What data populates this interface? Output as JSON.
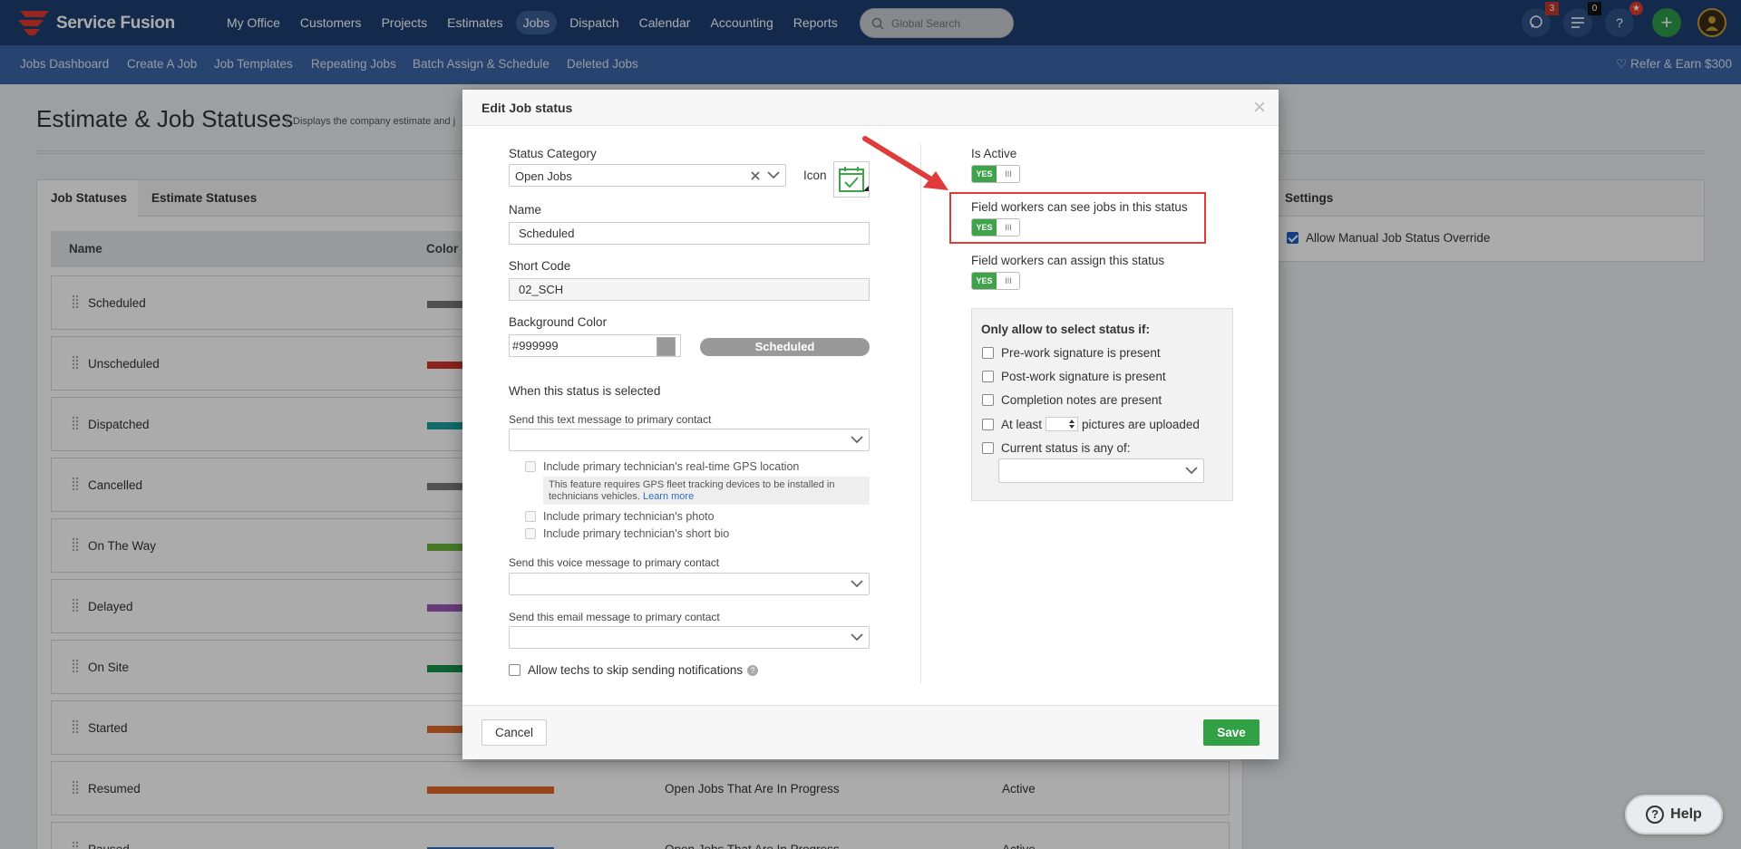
{
  "app": {
    "brand": "Service Fusion",
    "nav": [
      "My Office",
      "Customers",
      "Projects",
      "Estimates",
      "Jobs",
      "Dispatch",
      "Calendar",
      "Accounting",
      "Reports"
    ],
    "active_nav": "Jobs",
    "search_placeholder": "Global Search",
    "badges": {
      "chat": "3",
      "list": "0"
    },
    "help_icon_label": "?",
    "plus_label": "+"
  },
  "subnav": {
    "items": [
      "Jobs Dashboard",
      "Create A Job",
      "Job Templates",
      "Repeating Jobs",
      "Batch Assign & Schedule",
      "Deleted Jobs"
    ],
    "refer": "Refer & Earn $300"
  },
  "page": {
    "title": "Estimate & Job Statuses",
    "subtitle": "Displays the company estimate and j"
  },
  "tabs": [
    "Job Statuses",
    "Estimate Statuses"
  ],
  "table": {
    "headers": {
      "name": "Name",
      "color": "Color"
    },
    "rows": [
      {
        "name": "Scheduled",
        "color": "#7a7a7a",
        "category": "",
        "status": ""
      },
      {
        "name": "Unscheduled",
        "color": "#d0342c",
        "category": "",
        "status": ""
      },
      {
        "name": "Dispatched",
        "color": "#1a9d9d",
        "category": "",
        "status": ""
      },
      {
        "name": "Cancelled",
        "color": "#7a7a7a",
        "category": "",
        "status": ""
      },
      {
        "name": "On The Way",
        "color": "#6bb53e",
        "category": "",
        "status": ""
      },
      {
        "name": "Delayed",
        "color": "#9b59b6",
        "category": "",
        "status": ""
      },
      {
        "name": "On Site",
        "color": "#17934e",
        "category": "",
        "status": ""
      },
      {
        "name": "Started",
        "color": "#e06a2a",
        "category": "",
        "status": ""
      },
      {
        "name": "Resumed",
        "color": "#e0662a",
        "category": "Open Jobs That Are In Progress",
        "status": "Active"
      },
      {
        "name": "Paused",
        "color": "#2c6fc0",
        "category": "Open Jobs That Are In Progress",
        "status": "Active"
      }
    ]
  },
  "settings": {
    "title": "Settings",
    "allow_override": "Allow Manual Job Status Override"
  },
  "modal": {
    "title": "Edit Job status",
    "status_category_label": "Status Category",
    "status_category_value": "Open Jobs",
    "icon_label": "Icon",
    "name_label": "Name",
    "name_value": "Scheduled",
    "short_code_label": "Short Code",
    "short_code_value": "02_SCH",
    "bg_color_label": "Background Color",
    "bg_color_value": "#999999",
    "bg_color": "#999999",
    "preview_label": "Scheduled",
    "when_selected": "When this status is selected",
    "text_msg_label": "Send this text message to primary contact",
    "gps_label": "Include primary technician's real-time GPS location",
    "gps_note": "This feature requires GPS fleet tracking devices to be installed in technicians vehicles.",
    "learn_more": "Learn more",
    "photo_label": "Include primary technician's photo",
    "bio_label": "Include primary technician's short bio",
    "voice_msg_label": "Send this voice message to primary contact",
    "email_msg_label": "Send this email message to primary contact",
    "skip_label": "Allow techs to skip sending notifications",
    "is_active_label": "Is Active",
    "see_jobs_label": "Field workers can see jobs in this status",
    "assign_label": "Field workers can assign this status",
    "toggle_yes": "YES",
    "toggle_grip": "III",
    "only_allow_title": "Only allow to select status if:",
    "cond_prework": "Pre-work signature is present",
    "cond_postwork": "Post-work signature is present",
    "cond_notes": "Completion notes are present",
    "cond_at_least": "At least",
    "cond_pictures": "pictures are uploaded",
    "cond_current": "Current status is any of:",
    "cancel": "Cancel",
    "save": "Save"
  },
  "help": {
    "label": "Help"
  }
}
